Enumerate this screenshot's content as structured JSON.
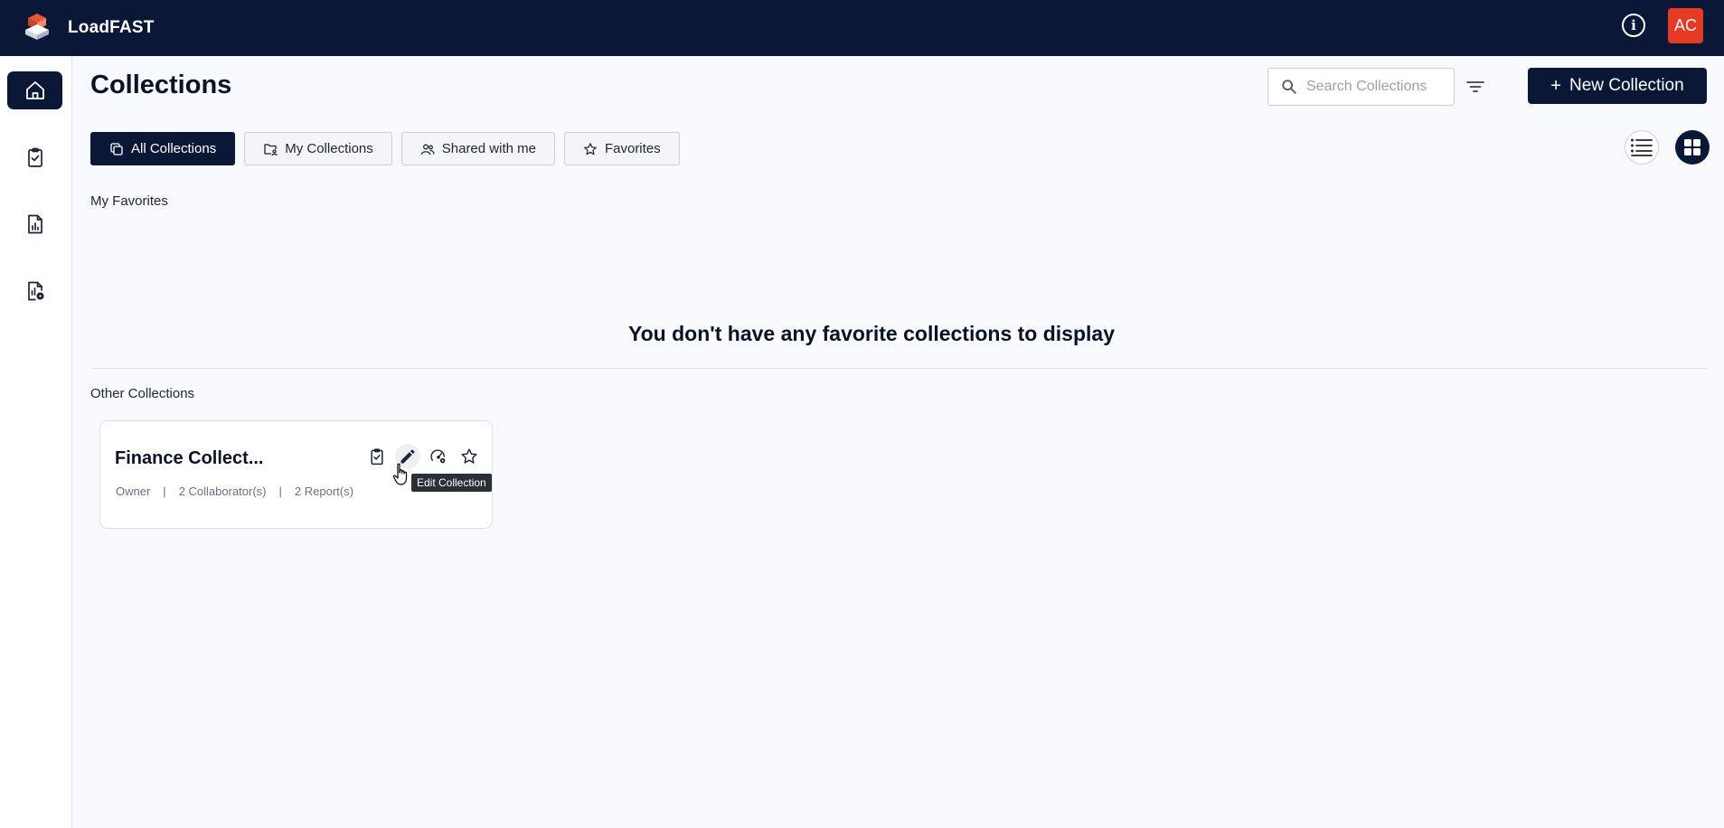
{
  "app": {
    "name": "LoadFAST",
    "user_initials": "AC"
  },
  "colors": {
    "nav_bg": "#0b1736",
    "avatar_bg": "#e53a23",
    "page_bg": "#f7f9fc"
  },
  "sidebar": {
    "items": [
      {
        "icon": "home-icon",
        "active": true
      },
      {
        "icon": "clipboard-check-icon",
        "active": false
      },
      {
        "icon": "report-chart-icon",
        "active": false
      },
      {
        "icon": "report-settings-icon",
        "active": false
      }
    ]
  },
  "header": {
    "title": "Collections",
    "search_placeholder": "Search Collections",
    "new_button_label": "New Collection"
  },
  "tabs": [
    {
      "label": "All Collections",
      "icon": "copy-icon",
      "active": true
    },
    {
      "label": "My Collections",
      "icon": "folder-user-icon",
      "active": false
    },
    {
      "label": "Shared with me",
      "icon": "users-icon",
      "active": false
    },
    {
      "label": "Favorites",
      "icon": "star-icon",
      "active": false
    }
  ],
  "favorites": {
    "label": "My Favorites",
    "empty_message": "You don't have any favorite collections to display"
  },
  "other": {
    "label": "Other Collections",
    "cards": [
      {
        "title": "Finance Collect...",
        "role": "Owner",
        "separator": "|",
        "collaborators": "2 Collaborator(s)",
        "reports": "2 Report(s)"
      }
    ]
  },
  "tooltip": "Edit Collection"
}
